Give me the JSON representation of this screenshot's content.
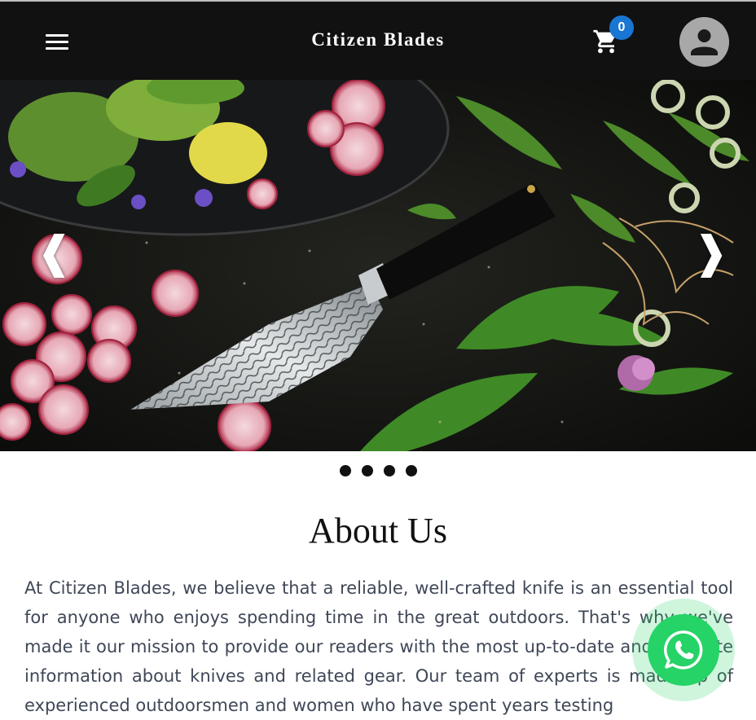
{
  "header": {
    "menu_icon": "hamburger-menu-icon",
    "brand": "Citizen Blades",
    "cart_icon": "shopping-cart-icon",
    "cart_count": "0",
    "account_icon": "account-person-icon"
  },
  "hero": {
    "image_subject": "Damascus steel knife on dark wood with radishes and herbs",
    "prev_arrow": "❰",
    "next_arrow": "❱",
    "dots_count": 4
  },
  "about": {
    "title": "About Us",
    "body": "At Citizen Blades, we believe that a reliable, well-crafted knife is an essential tool for anyone who enjoys spending time in the great outdoors. That's why we've made it our mission to provide our readers with the most up-to-date and accurate information about knives and related gear. Our team of experts is made up of experienced outdoorsmen and women who have spent years testing"
  },
  "floating": {
    "whatsapp_icon": "whatsapp-icon"
  },
  "colors": {
    "header_bg": "#111111",
    "badge": "#1976d2",
    "whatsapp": "#25d366",
    "body_text": "#3f4757"
  }
}
